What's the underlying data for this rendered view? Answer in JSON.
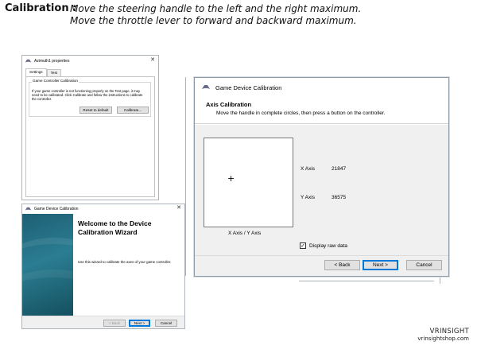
{
  "header": {
    "label": "Calibration :",
    "line1": "Move the steering handle to the left and  the right maximum.",
    "line2": "Move the throttle lever to forward and backward maximum."
  },
  "properties_window": {
    "title": "Azimuth1 properties",
    "tabs": [
      {
        "label": "Settings",
        "active": true
      },
      {
        "label": "Test",
        "active": false
      }
    ],
    "group_title": "Game Controller Calibration",
    "group_text": "If your game controller is not functioning properly on the Test page, it may need to be calibrated. Click Calibrate and follow the instructions to calibrate the controller.",
    "reset_button": "Reset to default",
    "calibrate_button": "Calibrate..."
  },
  "wizard_window": {
    "title": "Game Device Calibration",
    "heading": "Welcome to the Device Calibration Wizard",
    "text": "Use this wizard to calibrate the axes of your game controller.",
    "back_button": "< Back",
    "next_button": "Next >",
    "cancel_button": "Cancel"
  },
  "calibration_window": {
    "title": "Game Device Calibration",
    "section_title": "Axis Calibration",
    "instruction": "Move the handle in complete circles, then press a button on the controller.",
    "crosshair": "+",
    "axis_caption": "X Axis / Y Axis",
    "x_axis_label": "X Axis",
    "x_axis_value": "21847",
    "y_axis_label": "Y Axis",
    "y_axis_value": "36575",
    "raw_data_label": "Display raw data",
    "raw_data_checked": true,
    "back_button": "< Back",
    "next_button": "Next >",
    "cancel_button": "Cancel"
  },
  "brand": {
    "name": "VRINSIGHT",
    "url": "vrinsightshop.com"
  },
  "colors": {
    "wizard_panel": "#2b7d92",
    "default_button_border": "#0078d7",
    "dialog_background": "#f0f0f0"
  },
  "icons": {
    "close": "close-icon",
    "app": "controller-icon",
    "checkmark": "checkmark-icon"
  }
}
